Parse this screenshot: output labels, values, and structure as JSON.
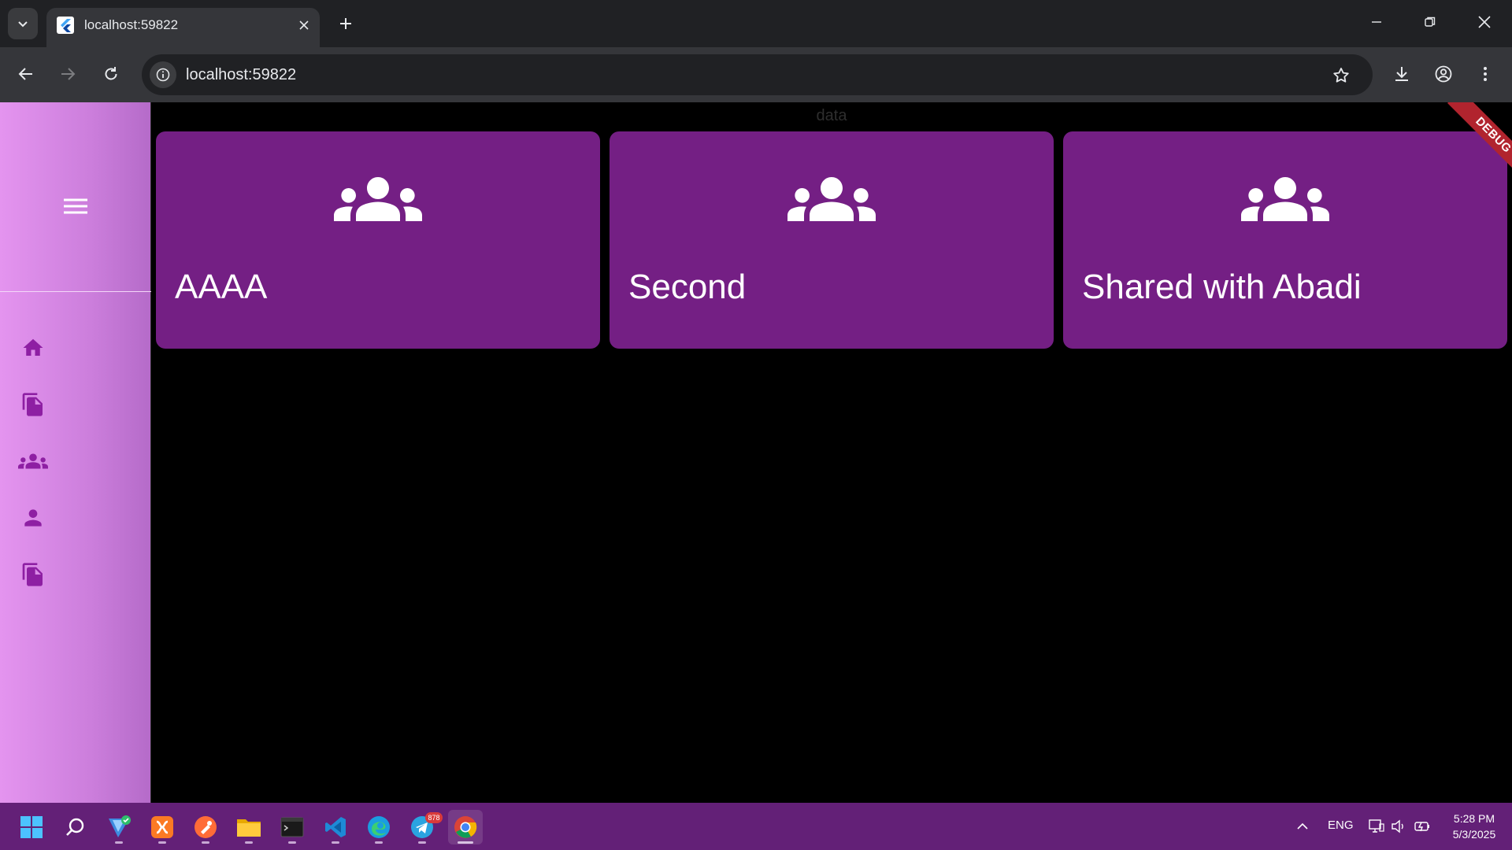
{
  "browser": {
    "tab_title": "localhost:59822",
    "url": "localhost:59822"
  },
  "page": {
    "header": "data",
    "debug_banner": "DEBUG",
    "sidebar": {
      "nav_items": [
        "home-icon",
        "file-copy-icon",
        "groups-icon",
        "person-icon",
        "file-copy-icon"
      ]
    },
    "cards": [
      {
        "title": "AAAA",
        "icon": "groups-icon"
      },
      {
        "title": "Second",
        "icon": "groups-icon"
      },
      {
        "title": "Shared with Abadi",
        "icon": "groups-icon"
      }
    ]
  },
  "taskbar": {
    "apps": [
      "windows-start",
      "search",
      "vector-app",
      "xampp",
      "postman",
      "file-explorer",
      "terminal",
      "vs-code",
      "edge",
      "telegram",
      "chrome"
    ],
    "telegram_badge": "878",
    "language": "ENG",
    "time": "5:28 PM",
    "date": "5/3/2025"
  },
  "colors": {
    "card": "#741f84",
    "taskbar": "#632077",
    "sidebar_gradient_start": "#e494ef",
    "sidebar_gradient_end": "#b56bc9",
    "accent_icon": "#8e1fa3"
  }
}
